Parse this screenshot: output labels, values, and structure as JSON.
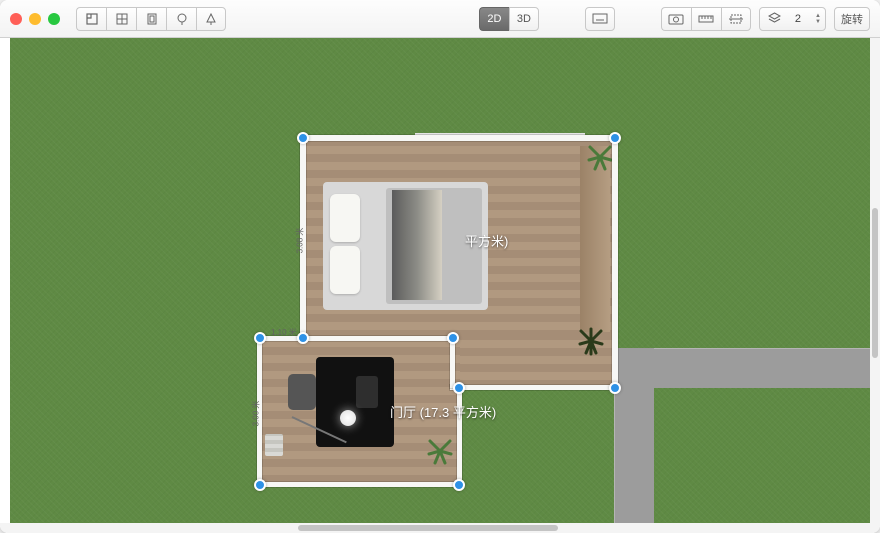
{
  "toolbar": {
    "view2d_label": "2D",
    "view3d_label": "3D",
    "rotate_label": "旋转"
  },
  "floor_selector": {
    "icon": "layers",
    "value": "2"
  },
  "rooms": {
    "bedroom": {
      "area_suffix": "平方米)"
    },
    "hall": {
      "label": "门厅 (17.3 平方米)"
    }
  },
  "dimensions": {
    "bedroom_left": "3.08 米",
    "hall_top": "1.10 米",
    "hall_left": "3.00 米"
  }
}
